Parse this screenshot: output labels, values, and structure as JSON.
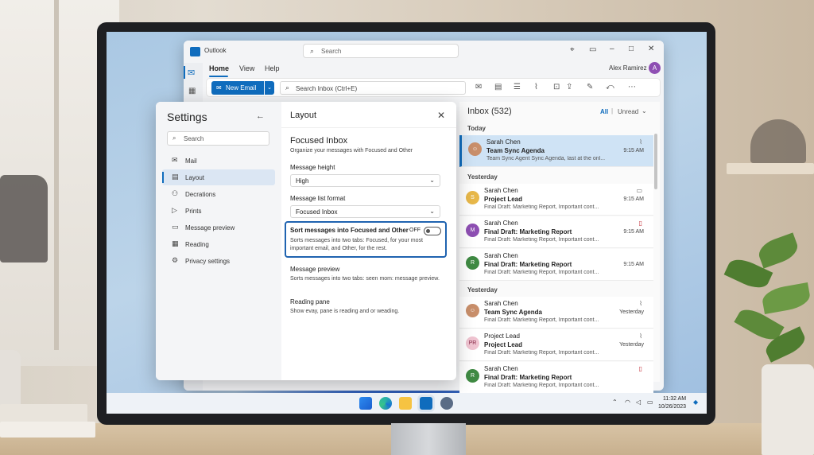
{
  "titlebar": {
    "app_title": "Outlook",
    "search_placeholder": "Search"
  },
  "ribbon_tabs": [
    {
      "label": "Home"
    },
    {
      "label": "View"
    },
    {
      "label": "Help"
    }
  ],
  "user": {
    "name": "Alex Ramirez",
    "initial": "A"
  },
  "ribbon": {
    "new_email_label": "New Email",
    "search_placeholder": "Search Inbox (Ctrl+E)"
  },
  "settings": {
    "title": "Settings",
    "search_placeholder": "Search",
    "nav": [
      {
        "label": "Mail",
        "icon": "mail-icon"
      },
      {
        "label": "Layout",
        "icon": "layout-icon",
        "active": true
      },
      {
        "label": "Decrations",
        "icon": "people-icon"
      },
      {
        "label": "Prints",
        "icon": "send-icon"
      },
      {
        "label": "Message preview",
        "icon": "preview-icon"
      },
      {
        "label": "Reading",
        "icon": "calendar-icon"
      },
      {
        "label": "Privacy settings",
        "icon": "gear-icon"
      }
    ],
    "panel": {
      "heading": "Layout",
      "section_title": "Focused Inbox",
      "section_subtitle": "Organize your messages with Focused and Other",
      "message_height_label": "Message height",
      "message_height_value": "High",
      "message_list_format_label": "Message list format",
      "message_list_format_value": "Focused Inbox",
      "focused_toggle": {
        "title": "Sort messages into Focused and Other",
        "state_label": "OFF",
        "description": "Sorts messages into two tabs: Focused, for your most important email, and Other, for the rest."
      },
      "message_preview": {
        "title": "Message preview",
        "description": "Sorts messages into two tabs: seen mom: message preview."
      },
      "reading_pane": {
        "title": "Reading pane",
        "description": "Show evay, pane is reading and or weading."
      }
    }
  },
  "inbox": {
    "title": "Inbox (532)",
    "filter_all": "All",
    "filter_unread": "Unread",
    "groups": [
      {
        "label": "Today"
      },
      {
        "label": "Yesterday"
      },
      {
        "label": "Yesterday"
      }
    ],
    "messages": [
      {
        "sender": "Sarah Chen",
        "subject": "Team Sync Agenda",
        "preview": "Team Sync Agent Sync Agenda, last at the onl...",
        "time": "9:15 AM",
        "avatar": "",
        "color": "#c98f6b",
        "icon": "paperclip-icon",
        "selected": true
      },
      {
        "sender": "Sarah Chen",
        "subject": "Project Lead",
        "preview": "Final Draft: Marketing Report, Important cont...",
        "time": "9:15 AM",
        "avatar": "S",
        "color": "#e8b84a",
        "icon": "calendar-icon"
      },
      {
        "sender": "Sarah Chen",
        "subject": "Final Draft: Marketing Report",
        "preview": "Final Draft: Marketing Report, Important cont...",
        "time": "9:15 AM",
        "avatar": "M",
        "color": "#8e4fb3",
        "icon": "trash-icon"
      },
      {
        "sender": "Sarah Chen",
        "subject": "Final Draft: Marketing Report",
        "preview": "Final Draft: Marketing Report, Important cont...",
        "time": "9:15 AM",
        "avatar": "R",
        "color": "#3f8a43",
        "icon": ""
      },
      {
        "sender": "Sarah Chen",
        "subject": "Team Sync Agenda",
        "preview": "Final Draft: Marketing Report, Important cont...",
        "time": "Yesterday",
        "avatar": "",
        "color": "#c98f6b",
        "icon": "paperclip-icon"
      },
      {
        "sender": "Project Lead",
        "subject": "Project Lead",
        "preview": "Final Draft: Marketing Report, Important cont...",
        "time": "Yesterday",
        "avatar": "PR",
        "color": "#f0c4d1",
        "icon": "paperclip-icon"
      },
      {
        "sender": "Sarah Chen",
        "subject": "Final Draft: Marketing Report",
        "preview": "Final Draft: Marketing Report, Important cont...",
        "time": "",
        "avatar": "R",
        "color": "#3f8a43",
        "icon": "trash-icon"
      }
    ]
  },
  "taskbar": {
    "time": "11:32 AM",
    "date": "10/26/2023"
  },
  "colors": {
    "accent": "#0f6cbd",
    "toggle_border": "#1f63b0"
  }
}
